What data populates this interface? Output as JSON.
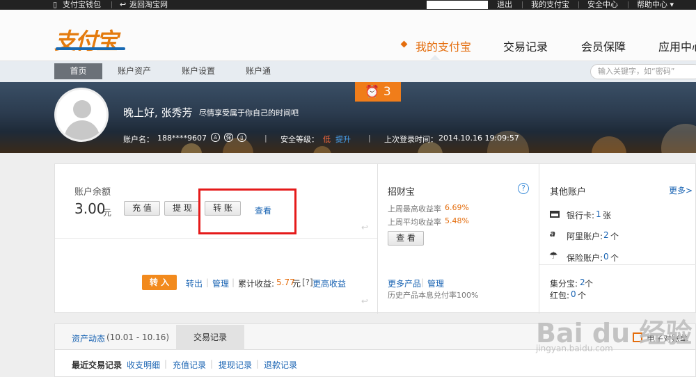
{
  "topbar": {
    "wallet": "支付宝钱包",
    "back_taobao": "返回淘宝网",
    "logout": "退出",
    "my_alipay": "我的支付宝",
    "security": "安全中心",
    "help": "帮助中心 ▾"
  },
  "header": {
    "logo": "支付宝",
    "nav": [
      "我的支付宝",
      "交易记录",
      "会员保障",
      "应用中心"
    ]
  },
  "subnav": {
    "tabs": [
      "首页",
      "账户资产",
      "账户设置",
      "账户通"
    ],
    "search_placeholder": "输入关键字，如“密码”"
  },
  "banner": {
    "greeting": "晚上好, 张秀芳",
    "greeting_sub": "尽情享受属于你自己的时间吧",
    "account_label": "账户名：",
    "account_name": "188****9607",
    "security_label": "安全等级：",
    "security_level": "低",
    "upgrade": "提升",
    "last_login_label": "上次登录时间：",
    "last_login": "2014.10.16 19:09:57",
    "alarm_count": "3",
    "icon_badges": [
      "♙",
      "保",
      "▯"
    ]
  },
  "balance": {
    "label": "账户余额",
    "amount": "3.00",
    "unit": "元",
    "recharge": "充 值",
    "withdraw": "提 现",
    "transfer": "转 账",
    "view": "查看"
  },
  "yuebao": {
    "transfer_in": "转 入",
    "transfer_out": "转出",
    "manage": "管理",
    "earnings_label": "累计收益:",
    "earnings": "5.77",
    "earnings_unit": "元",
    "help_mark": "[?]",
    "more_earnings": "更高收益"
  },
  "zhaocaibao": {
    "title": "招财宝",
    "weekly_high_label": "上周最高收益率",
    "weekly_high": "6.69%",
    "weekly_avg_label": "上周平均收益率",
    "weekly_avg": "5.48%",
    "view": "查 看",
    "more_products": "更多产品",
    "manage": "管理",
    "history": "历史产品本息兑付率100%"
  },
  "other_accounts": {
    "title": "其他账户",
    "more": "更多>",
    "bank_card": "银行卡:",
    "bank_count": "1",
    "bank_unit": "张",
    "ali_account": "阿里账户:",
    "ali_count": "2",
    "ali_unit": "个",
    "insurance": "保险账户:",
    "insurance_count": "0",
    "insurance_unit": "个",
    "jifen": "集分宝:",
    "jifen_count": "2",
    "jifen_unit": "个",
    "hongbao": "红包:",
    "hongbao_count": "0",
    "hongbao_unit": "个"
  },
  "bottom": {
    "asset_dynamic": "资产动态",
    "date_range": "(10.01 - 10.16)",
    "tab_records": "交易记录",
    "e_bill": "电子对账单",
    "recent_label": "最近交易记录",
    "links": [
      "收支明细",
      "充值记录",
      "提现记录",
      "退款记录"
    ]
  },
  "watermark": {
    "brand": "Bai du 经验",
    "url": "jingyan.baidu.com"
  },
  "colors": {
    "accent_orange": "#e46d0d",
    "link_blue": "#1a64b3",
    "highlight_red": "#e51a1a"
  }
}
